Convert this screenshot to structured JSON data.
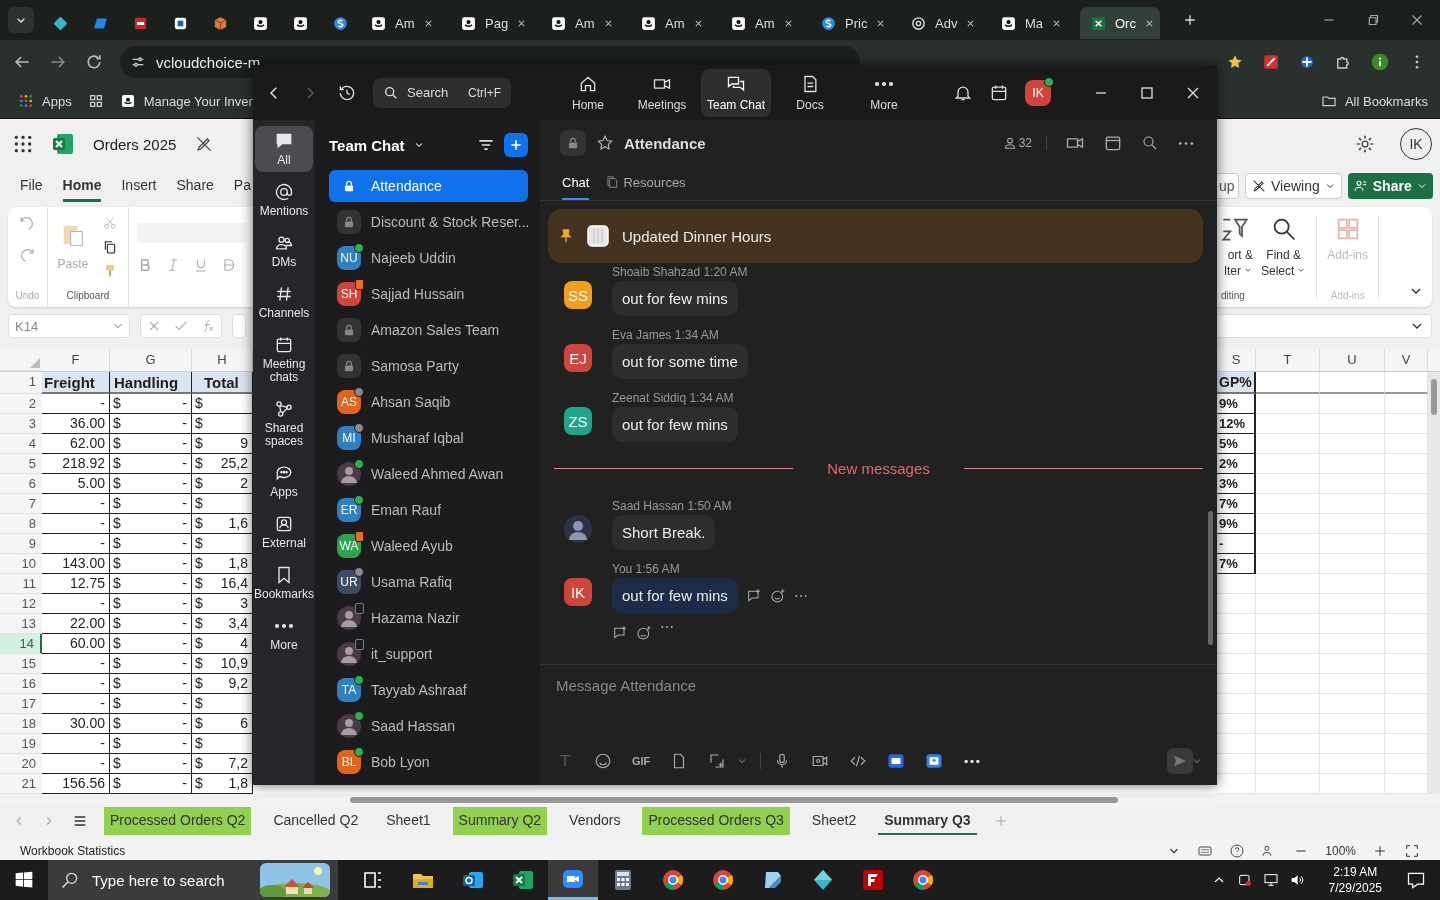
{
  "browser": {
    "tabs": [
      {
        "kind": "diamond",
        "selected": false
      },
      {
        "kind": "parallelogram",
        "selected": false
      },
      {
        "kind": "square",
        "selected": false
      },
      {
        "kind": "tile",
        "selected": false
      },
      {
        "kind": "cube",
        "selected": false
      },
      {
        "kind": "smile",
        "selected": false
      },
      {
        "kind": "smile",
        "selected": false
      },
      {
        "kind": "coin",
        "selected": false
      },
      {
        "kind": "smile",
        "title": "Am",
        "selected": false
      },
      {
        "kind": "smile",
        "title": "Pag",
        "selected": false
      },
      {
        "kind": "smile",
        "title": "Am",
        "selected": false
      },
      {
        "kind": "smile",
        "title": "Am",
        "selected": false
      },
      {
        "kind": "smile",
        "title": "Am",
        "selected": false
      },
      {
        "kind": "coin",
        "title": "Pric",
        "selected": false
      },
      {
        "kind": "knot",
        "title": "Adv",
        "selected": false
      },
      {
        "kind": "smile",
        "title": "Ma",
        "selected": false
      },
      {
        "kind": "sheet",
        "title": "Orc",
        "selected": true
      }
    ],
    "url": "vcloudchoice-m",
    "bookmarks": [
      {
        "label": "Apps"
      },
      {
        "label": "Manage Your Inven"
      }
    ],
    "all_bookmarks": "All Bookmarks"
  },
  "excel": {
    "title": "Orders 2025",
    "avatar": "IK",
    "ribbon_tabs": [
      {
        "label": "File",
        "selected": false
      },
      {
        "label": "Home",
        "selected": true
      },
      {
        "label": "Insert",
        "selected": false
      },
      {
        "label": "Share",
        "selected": false
      },
      {
        "label": "Pa",
        "selected": false
      }
    ],
    "catch_up": "up",
    "viewing": "Viewing",
    "share": "Share",
    "undo_group": "Undo",
    "paste": "Paste",
    "clipboard_group": "Clipboard",
    "sort": [
      "ort &",
      "lter"
    ],
    "find": [
      "Find &",
      "Select"
    ],
    "editing_group": "diting",
    "addins": "Add-ins",
    "addins_group": "Add-ins",
    "name_box": "K14",
    "columns_left": [
      "F",
      "G",
      "H"
    ],
    "columns_right": [
      "S",
      "T",
      "U",
      "V"
    ],
    "rows": [
      {
        "number": "1",
        "selected": false,
        "kind": "header",
        "F": "Freight",
        "G": "Handling",
        "H": "Total",
        "S": "GP%"
      },
      {
        "number": "2",
        "selected": false,
        "F": "-",
        "G_sign": "$",
        "G": "-",
        "H_sign": "$",
        "S": "9%"
      },
      {
        "number": "3",
        "selected": false,
        "F": "36.00",
        "G_sign": "$",
        "G": "-",
        "H_sign": "$",
        "S": "12%"
      },
      {
        "number": "4",
        "selected": false,
        "F": "62.00",
        "G_sign": "$",
        "G": "-",
        "H_sign": "$",
        "H": "9",
        "S": "5%"
      },
      {
        "number": "5",
        "selected": false,
        "F": "218.92",
        "G_sign": "$",
        "G": "-",
        "H_sign": "$",
        "H": "25,2",
        "S": "2%"
      },
      {
        "number": "6",
        "selected": false,
        "F": "5.00",
        "G_sign": "$",
        "G": "-",
        "H_sign": "$",
        "H": "2",
        "S": "3%"
      },
      {
        "number": "7",
        "selected": false,
        "F": "-",
        "G_sign": "$",
        "G": "-",
        "H_sign": "$",
        "S": "7%"
      },
      {
        "number": "8",
        "selected": false,
        "F": "-",
        "G_sign": "$",
        "G": "-",
        "H_sign": "$",
        "H": "1,6",
        "S": "9%"
      },
      {
        "number": "9",
        "selected": false,
        "F": "-",
        "G_sign": "$",
        "G": "-",
        "H_sign": "$",
        "S": "-"
      },
      {
        "number": "10",
        "selected": false,
        "F": "143.00",
        "G_sign": "$",
        "G": "-",
        "H_sign": "$",
        "H": "1,8",
        "S": "7%"
      },
      {
        "number": "11",
        "selected": false,
        "F": "12.75",
        "G_sign": "$",
        "G": "-",
        "H_sign": "$",
        "H": "16,4"
      },
      {
        "number": "12",
        "selected": false,
        "F": "-",
        "G_sign": "$",
        "G": "-",
        "H_sign": "$",
        "H": "3"
      },
      {
        "number": "13",
        "selected": false,
        "F": "22.00",
        "G_sign": "$",
        "G": "-",
        "H_sign": "$",
        "H": "3,4"
      },
      {
        "number": "14",
        "selected": true,
        "F": "60.00",
        "G_sign": "$",
        "G": "-",
        "H_sign": "$",
        "H": "4"
      },
      {
        "number": "15",
        "selected": false,
        "F": "-",
        "G_sign": "$",
        "G": "-",
        "H_sign": "$",
        "H": "10,9"
      },
      {
        "number": "16",
        "selected": false,
        "F": "-",
        "G_sign": "$",
        "G": "-",
        "H_sign": "$",
        "H": "9,2"
      },
      {
        "number": "17",
        "selected": false,
        "F": "-",
        "G_sign": "$",
        "G": "-",
        "H_sign": "$"
      },
      {
        "number": "18",
        "selected": false,
        "F": "30.00",
        "G_sign": "$",
        "G": "-",
        "H_sign": "$",
        "H": "6"
      },
      {
        "number": "19",
        "selected": false,
        "F": "-",
        "G_sign": "$",
        "G": "-",
        "H_sign": "$"
      },
      {
        "number": "20",
        "selected": false,
        "F": "-",
        "G_sign": "$",
        "G": "-",
        "H_sign": "$",
        "H": "7,2"
      },
      {
        "number": "21",
        "selected": false,
        "F": "156.56",
        "G_sign": "$",
        "G": "-",
        "H_sign": "$",
        "H": "1,8"
      }
    ],
    "sheet_tabs": [
      {
        "label": "Processed Orders Q2",
        "color": "#92d050",
        "selected": false
      },
      {
        "label": "Cancelled Q2",
        "selected": false
      },
      {
        "label": "Sheet1",
        "selected": false
      },
      {
        "label": "Summary Q2",
        "color": "#92d050",
        "selected": false
      },
      {
        "label": "Vendors",
        "selected": false
      },
      {
        "label": "Processed Orders Q3",
        "color": "#92d050",
        "selected": false
      },
      {
        "label": "Sheet2",
        "selected": false
      },
      {
        "label": "Summary Q3",
        "selected": true
      }
    ],
    "status": "Workbook Statistics",
    "zoom": "100%"
  },
  "zoom": {
    "search": {
      "placeholder": "Search",
      "shortcut": "Ctrl+F"
    },
    "nav": [
      {
        "label": "Home",
        "selected": false
      },
      {
        "label": "Meetings",
        "selected": false
      },
      {
        "label": "Team Chat",
        "selected": true
      },
      {
        "label": "Docs",
        "selected": false
      },
      {
        "label": "More",
        "selected": false
      }
    ],
    "avatar": "IK",
    "rail": [
      {
        "label": "All",
        "selected": true
      },
      {
        "label": "Mentions",
        "selected": false
      },
      {
        "label": "DMs",
        "selected": false
      },
      {
        "label": "Channels",
        "selected": false
      },
      {
        "label": "Meeting chats",
        "selected": false
      },
      {
        "label": "Shared spaces",
        "selected": false
      },
      {
        "label": "Apps",
        "selected": false
      },
      {
        "label": "External",
        "selected": false
      },
      {
        "label": "Bookmarks",
        "selected": false
      },
      {
        "label": "More",
        "selected": false
      }
    ],
    "list_title": "Team Chat",
    "chats": [
      {
        "kind": "channel",
        "name": "Attendance",
        "selected": true
      },
      {
        "kind": "channel",
        "name": "Discount & Stock Reser...",
        "selected": false
      },
      {
        "kind": "person",
        "name": "Najeeb Uddin",
        "initials": "NU",
        "color": "#2f7fc1",
        "presence": {
          "kind": "available",
          "color": "#2bb24c"
        },
        "selected": false
      },
      {
        "kind": "person",
        "name": "Sajjad Hussain",
        "initials": "SH",
        "color": "#d0453b",
        "presence": {
          "kind": "meeting",
          "color": "#f26d21"
        },
        "selected": false
      },
      {
        "kind": "channel",
        "name": "Amazon Sales Team",
        "selected": false
      },
      {
        "kind": "channel",
        "name": "Samosa Party",
        "selected": false
      },
      {
        "kind": "person",
        "name": "Ahsan Saqib",
        "initials": "AS",
        "color": "#e2631c",
        "presence": {
          "kind": "away",
          "color": "#8a8a8a"
        },
        "selected": false
      },
      {
        "kind": "person",
        "name": "Musharaf Iqbal",
        "initials": "MI",
        "color": "#2f7fc1",
        "presence": {
          "kind": "offline",
          "color": "#8a8a8a"
        },
        "selected": false
      },
      {
        "kind": "person",
        "name": "Waleed Ahmed Awan",
        "presence": {
          "kind": "available",
          "color": "#2bb24c"
        },
        "selected": false
      },
      {
        "kind": "person",
        "name": "Eman Rauf",
        "initials": "ER",
        "color": "#2f7fc1",
        "presence": {
          "kind": "available",
          "color": "#2bb24c"
        },
        "selected": false
      },
      {
        "kind": "person",
        "name": "Waleed Ayub",
        "initials": "WA",
        "color": "#2ea44f",
        "presence": {
          "kind": "meeting",
          "color": "#f26d21"
        },
        "selected": false
      },
      {
        "kind": "person",
        "name": "Usama Rafiq",
        "initials": "UR",
        "color": "#3b4d66",
        "presence": {
          "kind": "offline",
          "color": "#8a8a8a"
        },
        "selected": false
      },
      {
        "kind": "person",
        "name": "Hazama Nazir",
        "presence": {
          "kind": "mobile",
          "color": "#2bb24c"
        },
        "selected": false
      },
      {
        "kind": "person",
        "name": "it_support",
        "presence": {
          "kind": "mobile",
          "color": "#2bb24c"
        },
        "selected": false
      },
      {
        "kind": "person",
        "name": "Tayyab Ashraaf",
        "initials": "TA",
        "color": "#2f7fc1",
        "presence": {
          "kind": "available",
          "color": "#2bb24c"
        },
        "selected": false
      },
      {
        "kind": "person",
        "name": "Saad Hassan",
        "presence": {
          "kind": "available",
          "color": "#2bb24c"
        },
        "selected": false
      },
      {
        "kind": "person",
        "name": "Bob Lyon",
        "initials": "BL",
        "color": "#e2631c",
        "presence": {
          "kind": "available",
          "color": "#2bb24c"
        },
        "selected": false
      }
    ],
    "channel": {
      "name": "Attendance",
      "members": "32"
    },
    "chat_tabs": [
      {
        "label": "Chat",
        "selected": true
      },
      {
        "label": "Resources",
        "selected": false
      }
    ],
    "pinned": "Updated Dinner Hours",
    "messages": [
      {
        "kind": "message",
        "sender": "Shoaib Shahzad",
        "time": "1:20 AM",
        "text": "out for few mins",
        "initials": "SS",
        "color": "#f29d1c",
        "own": false
      },
      {
        "kind": "message",
        "sender": "Eva James",
        "time": "1:34 AM",
        "text": "out for some time",
        "initials": "EJ",
        "color": "#d0453b",
        "own": false
      },
      {
        "kind": "message",
        "sender": "Zeenat Siddiq",
        "time": "1:34 AM",
        "text": "out for few mins",
        "initials": "ZS",
        "color": "#1fa58a",
        "own": false
      },
      {
        "kind": "divider",
        "label": "New messages"
      },
      {
        "kind": "message",
        "sender": "Saad Hassan",
        "time": "1:50 AM",
        "text": "Short Break.",
        "own": false
      },
      {
        "kind": "message",
        "sender": "You",
        "time": "1:56 AM",
        "text": "out for few mins",
        "initials": "IK",
        "color": "#d0453b",
        "own": true
      }
    ],
    "composer": {
      "placeholder": "Message Attendance",
      "gif": "GIF"
    }
  },
  "taskbar": {
    "search": {
      "placeholder": "Type here to search"
    },
    "time": "2:19 AM",
    "date": "7/29/2025"
  }
}
